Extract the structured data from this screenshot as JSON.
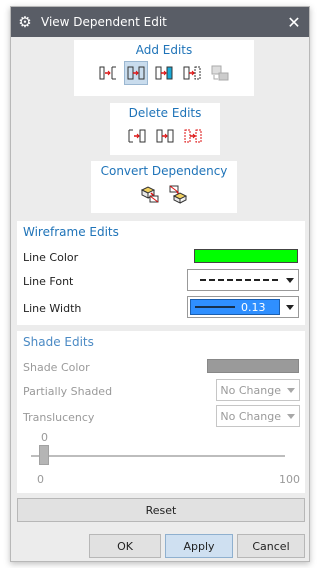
{
  "window": {
    "title": "View Dependent Edit"
  },
  "add_edits": {
    "title": "Add Edits"
  },
  "delete_edits": {
    "title": "Delete Edits"
  },
  "convert_dependency": {
    "title": "Convert Dependency"
  },
  "wireframe": {
    "title": "Wireframe Edits",
    "line_color_label": "Line Color",
    "line_color": "#00ff00",
    "line_font_label": "Line Font",
    "line_width_label": "Line Width",
    "line_width_value": "0.13",
    "line_width_bg": "#2f8fff"
  },
  "shade": {
    "title": "Shade Edits",
    "shade_color_label": "Shade Color",
    "partially_shaded_label": "Partially Shaded",
    "partially_shaded_value": "No Change",
    "translucency_label": "Translucency",
    "translucency_value": "No Change",
    "slider_value": "0",
    "slider_min": "0",
    "slider_max": "100"
  },
  "buttons": {
    "reset": "Reset",
    "ok": "OK",
    "apply": "Apply",
    "cancel": "Cancel"
  },
  "colors": {
    "accent": "#1e73b8",
    "titlebar": "#595d66"
  }
}
